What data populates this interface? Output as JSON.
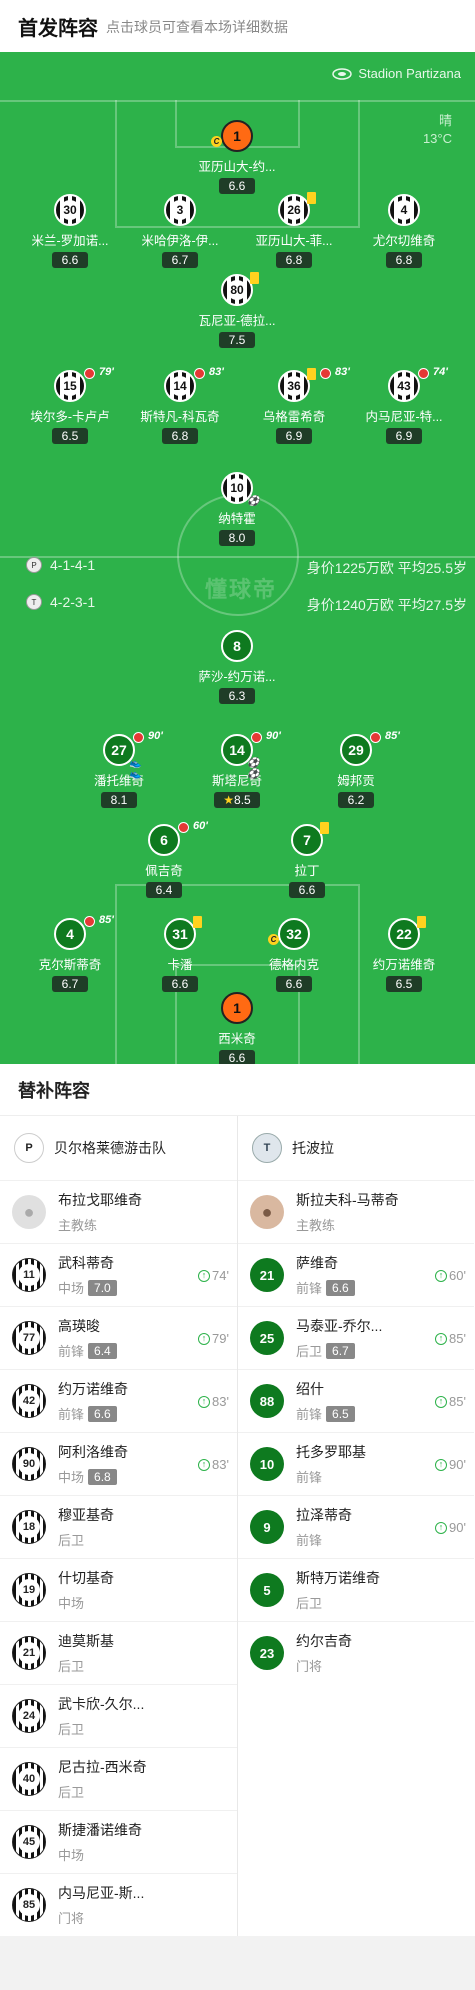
{
  "header": {
    "title": "首发阵容",
    "subtitle": "点击球员可查看本场详细数据"
  },
  "stadium": "Stadion Partizana",
  "weather": {
    "cond": "晴",
    "temp": "13°C"
  },
  "watermark": "懂球帝",
  "home": {
    "formation": "4-1-4-1",
    "worth": "身价1225万欧 平均25.5岁"
  },
  "away": {
    "formation": "4-2-3-1",
    "worth": "身价1240万欧 平均27.5岁"
  },
  "home_players": [
    {
      "no": "1",
      "name": "亚历山大-约...",
      "rating": "6.6"
    },
    {
      "no": "30",
      "name": "米兰-罗加诺...",
      "rating": "6.6"
    },
    {
      "no": "3",
      "name": "米哈伊洛-伊...",
      "rating": "6.7"
    },
    {
      "no": "26",
      "name": "亚历山大-菲...",
      "rating": "6.8"
    },
    {
      "no": "4",
      "name": "尤尔切维奇",
      "rating": "6.8"
    },
    {
      "no": "80",
      "name": "瓦尼亚-德拉...",
      "rating": "7.5"
    },
    {
      "no": "15",
      "name": "埃尔多-卡卢卢",
      "rating": "6.5",
      "sub": "79'"
    },
    {
      "no": "14",
      "name": "斯特凡-科瓦奇",
      "rating": "6.8",
      "sub": "83'"
    },
    {
      "no": "36",
      "name": "乌格雷希奇",
      "rating": "6.9",
      "sub": "83'"
    },
    {
      "no": "43",
      "name": "内马尼亚-特...",
      "rating": "6.9",
      "sub": "74'"
    },
    {
      "no": "10",
      "name": "纳特霍",
      "rating": "8.0"
    }
  ],
  "away_players": [
    {
      "no": "8",
      "name": "萨沙-约万诺...",
      "rating": "6.3"
    },
    {
      "no": "27",
      "name": "潘托维奇",
      "rating": "8.1",
      "sub": "90'"
    },
    {
      "no": "14",
      "name": "斯塔尼奇",
      "rating": "8.5",
      "sub": "90'"
    },
    {
      "no": "29",
      "name": "姆邦贡",
      "rating": "6.2",
      "sub": "85'"
    },
    {
      "no": "6",
      "name": "佩吉奇",
      "rating": "6.4",
      "sub": "60'"
    },
    {
      "no": "7",
      "name": "拉丁",
      "rating": "6.6"
    },
    {
      "no": "4",
      "name": "克尔斯蒂奇",
      "rating": "6.7",
      "sub": "85'"
    },
    {
      "no": "31",
      "name": "卡潘",
      "rating": "6.6"
    },
    {
      "no": "32",
      "name": "德格内克",
      "rating": "6.6"
    },
    {
      "no": "22",
      "name": "约万诺维奇",
      "rating": "6.5"
    },
    {
      "no": "1",
      "name": "西米奇",
      "rating": "6.6"
    }
  ],
  "bench": {
    "title": "替补阵容",
    "home_team": "贝尔格莱德游击队",
    "away_team": "托波拉",
    "home_coach": {
      "name": "布拉戈耶维奇",
      "role": "主教练"
    },
    "away_coach": {
      "name": "斯拉夫科-马蒂奇",
      "role": "主教练"
    },
    "home_subs": [
      {
        "no": "11",
        "name": "武科蒂奇",
        "pos": "中场",
        "rating": "7.0",
        "in": "74'"
      },
      {
        "no": "77",
        "name": "高瑛晙",
        "pos": "前锋",
        "rating": "6.4",
        "in": "79'"
      },
      {
        "no": "42",
        "name": "约万诺维奇",
        "pos": "前锋",
        "rating": "6.6",
        "in": "83'"
      },
      {
        "no": "90",
        "name": "阿利洛维奇",
        "pos": "中场",
        "rating": "6.8",
        "in": "83'"
      },
      {
        "no": "18",
        "name": "穆亚基奇",
        "pos": "后卫"
      },
      {
        "no": "19",
        "name": "什切基奇",
        "pos": "中场"
      },
      {
        "no": "21",
        "name": "迪莫斯基",
        "pos": "后卫"
      },
      {
        "no": "24",
        "name": "武卡欣-久尔...",
        "pos": "后卫"
      },
      {
        "no": "40",
        "name": "尼古拉-西米奇",
        "pos": "后卫"
      },
      {
        "no": "45",
        "name": "斯捷潘诺维奇",
        "pos": "中场"
      },
      {
        "no": "85",
        "name": "内马尼亚-斯...",
        "pos": "门将"
      }
    ],
    "away_subs": [
      {
        "no": "21",
        "name": "萨维奇",
        "pos": "前锋",
        "rating": "6.6",
        "in": "60'"
      },
      {
        "no": "25",
        "name": "马泰亚-乔尔...",
        "pos": "后卫",
        "rating": "6.7",
        "in": "85'"
      },
      {
        "no": "88",
        "name": "绍什",
        "pos": "前锋",
        "rating": "6.5",
        "in": "85'"
      },
      {
        "no": "10",
        "name": "托多罗耶基",
        "pos": "前锋",
        "in": "90'"
      },
      {
        "no": "9",
        "name": "拉泽蒂奇",
        "pos": "前锋",
        "in": "90'"
      },
      {
        "no": "5",
        "name": "斯特万诺维奇",
        "pos": "后卫"
      },
      {
        "no": "23",
        "name": "约尔吉奇",
        "pos": "门将"
      }
    ]
  }
}
